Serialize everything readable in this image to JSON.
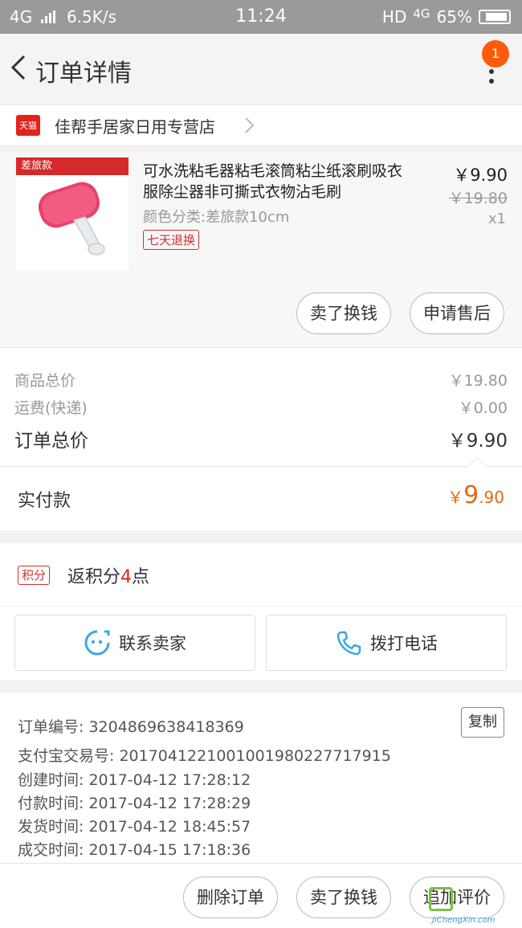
{
  "status_bar": {
    "network": "4G",
    "speed": "6.5K/s",
    "time": "11:24",
    "hd": "HD",
    "network_right": "4G",
    "battery": "65%"
  },
  "nav": {
    "title": "订单详情",
    "badge_count": "1"
  },
  "shop": {
    "badge": "天猫",
    "name": "佳帮手居家日用专营店"
  },
  "goods": {
    "image_tag": "差旅款",
    "title": "可水洗粘毛器粘毛滚筒粘尘纸滚刷吸衣服除尘器非可撕式衣物沾毛刷",
    "spec": "颜色分类:差旅款10cm",
    "return_tag": "七天退换",
    "price": "￥9.90",
    "original_price": "￥19.80",
    "quantity": "x1",
    "sell_button": "卖了换钱",
    "aftersale_button": "申请售后"
  },
  "summary": {
    "items_label": "商品总价",
    "items_value": "￥19.80",
    "shipping_label": "运费(快递)",
    "shipping_value": "￥0.00",
    "total_label": "订单总价",
    "total_value": "￥9.90"
  },
  "paid": {
    "label": "实付款",
    "currency": "￥",
    "integer": "9",
    "decimal": ".90"
  },
  "points": {
    "tag": "积分",
    "prefix": "返积分",
    "number": "4",
    "suffix": "点"
  },
  "contact": {
    "seller_label": "联系卖家",
    "phone_label": "拨打电话"
  },
  "order_info": {
    "order_no": "订单编号: 3204869638418369",
    "copy_label": "复制",
    "alipay_no": "支付宝交易号: 2017041221001001980227717915",
    "created": "创建时间: 2017-04-12 17:28:12",
    "paid_time": "付款时间: 2017-04-12 17:28:29",
    "shipped": "发货时间: 2017-04-12 18:45:57",
    "completed": "成交时间: 2017-04-15 17:18:36"
  },
  "bottom_bar": {
    "delete_label": "删除订单",
    "sell_label": "卖了换钱",
    "review_label": "追加评价"
  },
  "colors": {
    "accent_orange": "#e8690d",
    "tmall_red": "#e2231a",
    "badge_orange": "#ff5a0a",
    "icon_blue": "#39a9e0"
  }
}
